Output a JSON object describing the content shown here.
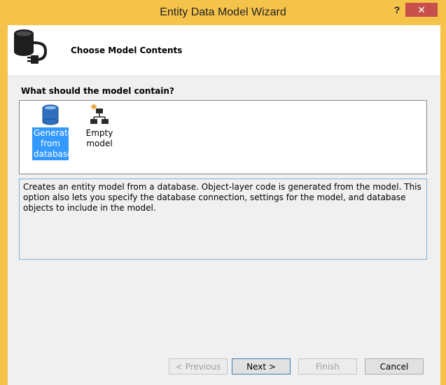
{
  "window": {
    "title": "Entity Data Model Wizard",
    "help_label": "?",
    "close_label": "✕"
  },
  "header": {
    "title": "Choose Model Contents",
    "icon": "database-plug-icon"
  },
  "content": {
    "question": "What should the model contain?",
    "options": [
      {
        "label": "Generate from database",
        "icon": "database-icon",
        "selected": true
      },
      {
        "label": "Empty model",
        "icon": "empty-model-icon",
        "selected": false
      }
    ],
    "description": "Creates an entity model from a database. Object-layer code is generated from the model. This option also lets you specify the database connection, settings for the model, and database objects to include in the model."
  },
  "buttons": {
    "previous": "< Previous",
    "next": "Next >",
    "finish": "Finish",
    "cancel": "Cancel"
  },
  "colors": {
    "frame": "#f6c34a",
    "close": "#c7504a",
    "selection": "#3399ff"
  }
}
